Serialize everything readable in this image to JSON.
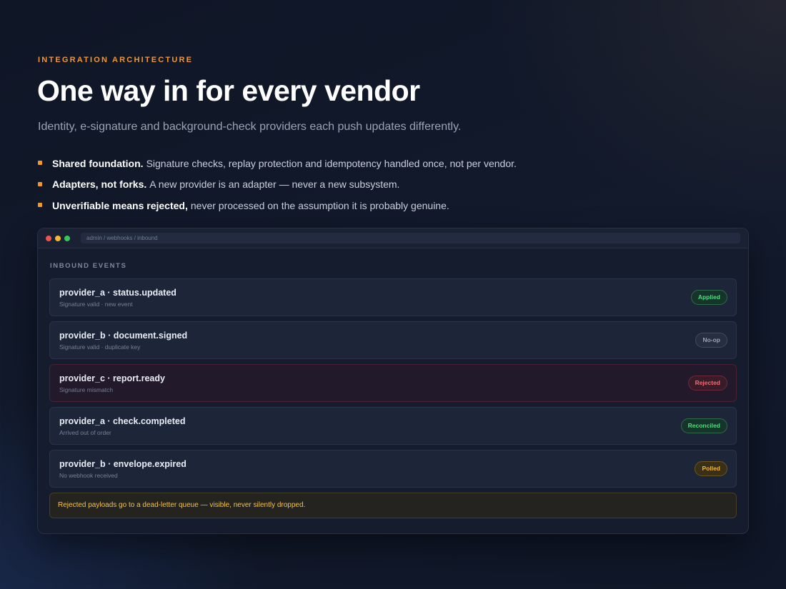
{
  "hero": {
    "eyebrow": "INTEGRATION ARCHITECTURE",
    "title": "One way in for every vendor",
    "subtitle": "Identity, e-signature and background-check providers each push updates differently."
  },
  "bullets": [
    {
      "strong": "Shared foundation.",
      "text": "Signature checks, replay protection and idempotency handled once, not per vendor."
    },
    {
      "strong": "Adapters, not forks.",
      "text": "A new provider is an adapter — never a new subsystem."
    },
    {
      "strong": "Unverifiable means rejected,",
      "text": "never processed on the assumption it is probably genuine."
    }
  ],
  "window": {
    "address": "admin / webhooks / inbound",
    "section_label": "INBOUND EVENTS",
    "events": [
      {
        "name": "provider_a · status.updated",
        "detail": "Signature valid · new event",
        "status": "Applied",
        "status_color": "#4ade80"
      },
      {
        "name": "provider_b · document.signed",
        "detail": "Signature valid · duplicate key",
        "status": "No-op",
        "status_color": "#9aa3b5"
      },
      {
        "name": "provider_c · report.ready",
        "detail": "Signature mismatch",
        "status": "Rejected",
        "status_color": "#f06a78"
      },
      {
        "name": "provider_a · check.completed",
        "detail": "Arrived out of order",
        "status": "Reconciled",
        "status_color": "#4ade80"
      },
      {
        "name": "provider_b · envelope.expired",
        "detail": "No webhook received",
        "status": "Polled",
        "status_color": "#f5b82e"
      }
    ],
    "notice": "Rejected payloads go to a dead-letter queue — visible, never silently dropped."
  },
  "colors": {
    "accent": "#f0982e",
    "window_dots": [
      "#ef5350",
      "#f5b82e",
      "#34c759"
    ]
  }
}
